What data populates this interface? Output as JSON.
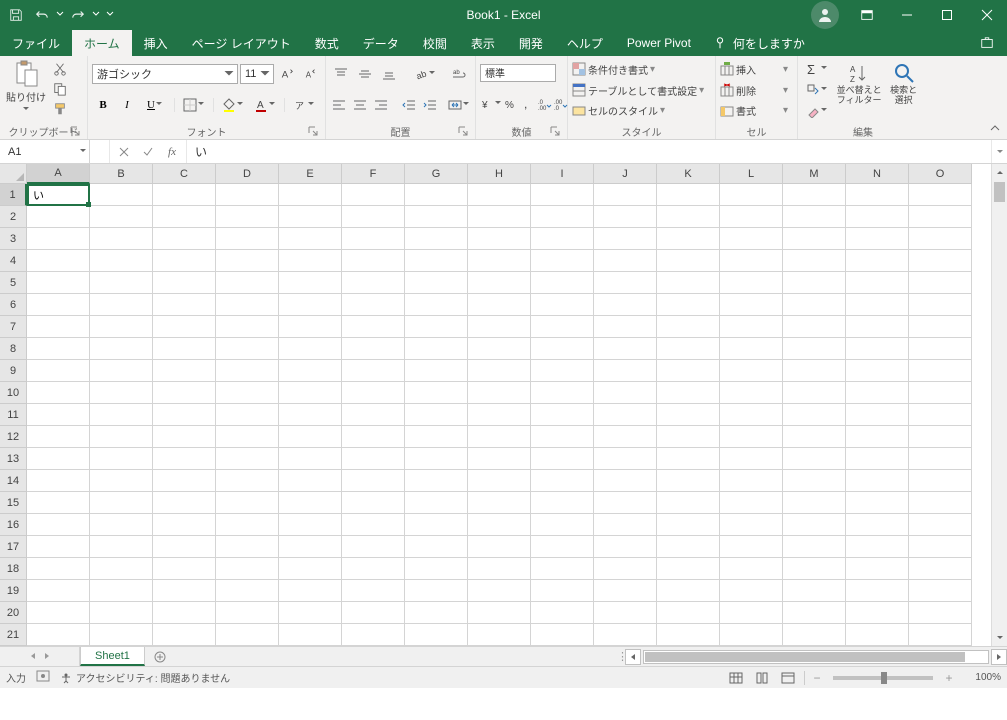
{
  "title": "Book1  -  Excel",
  "qat": {
    "save": "save",
    "undo": "undo",
    "redo": "redo"
  },
  "tabs": {
    "file": "ファイル",
    "home": "ホーム",
    "insert": "挿入",
    "page_layout": "ページ レイアウト",
    "formulas": "数式",
    "data": "データ",
    "review": "校閲",
    "view": "表示",
    "developer": "開発",
    "help": "ヘルプ",
    "power_pivot": "Power Pivot",
    "tell_me": "何をしますか"
  },
  "ribbon": {
    "clipboard": {
      "label": "クリップボード",
      "paste": "貼り付け"
    },
    "font": {
      "label": "フォント",
      "name": "游ゴシック",
      "size": "11",
      "bold": "B",
      "italic": "I",
      "underline": "U"
    },
    "alignment": {
      "label": "配置"
    },
    "number": {
      "label": "数値",
      "format": "標準"
    },
    "styles": {
      "label": "スタイル",
      "conditional": "条件付き書式",
      "table": "テーブルとして書式設定",
      "cell": "セルのスタイル"
    },
    "cells": {
      "label": "セル",
      "insert": "挿入",
      "delete": "削除",
      "format": "書式"
    },
    "editing": {
      "label": "編集",
      "sort": "並べ替えと\nフィルター",
      "find": "検索と\n選択"
    }
  },
  "name_box": "A1",
  "formula": "い",
  "active_cell_value": "い",
  "columns": [
    "A",
    "B",
    "C",
    "D",
    "E",
    "F",
    "G",
    "H",
    "I",
    "J",
    "K",
    "L",
    "M",
    "N",
    "O"
  ],
  "rows": [
    "1",
    "2",
    "3",
    "4",
    "5",
    "6",
    "7",
    "8",
    "9",
    "10",
    "11",
    "12",
    "13",
    "14",
    "15",
    "16",
    "17",
    "18",
    "19",
    "20",
    "21"
  ],
  "sheet": {
    "name": "Sheet1"
  },
  "status": {
    "mode": "入力",
    "accessibility": "アクセシビリティ: 問題ありません",
    "zoom": "100%"
  }
}
